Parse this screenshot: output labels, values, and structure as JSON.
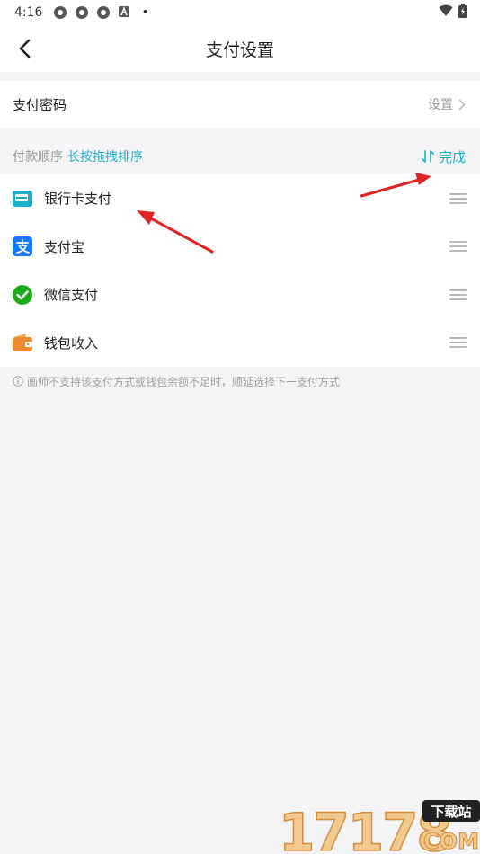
{
  "status_bar": {
    "time": "4:16"
  },
  "nav": {
    "title": "支付设置"
  },
  "payment_password": {
    "label": "支付密码",
    "value": "设置"
  },
  "order_section": {
    "label": "付款顺序",
    "hint": "长按拖拽排序",
    "done_label": "完成"
  },
  "payment_methods": [
    {
      "label": "银行卡支付",
      "icon": "bank-card-icon",
      "color": "#1ab0c9"
    },
    {
      "label": "支付宝",
      "icon": "alipay-icon",
      "color": "#1677ff"
    },
    {
      "label": "微信支付",
      "icon": "wechat-icon",
      "color": "#1aad19"
    },
    {
      "label": "钱包收入",
      "icon": "wallet-icon",
      "color": "#f08a30"
    }
  ],
  "footer_hint": "画师不支持该支付方式或钱包余额不足时，顺延选择下一支付方式",
  "watermark": {
    "number": "17178",
    "tag": "下载站",
    "domain": "COM"
  },
  "colors": {
    "accent": "#1ab0c9",
    "arrow": "#e02424",
    "background": "#f4f4f6"
  }
}
